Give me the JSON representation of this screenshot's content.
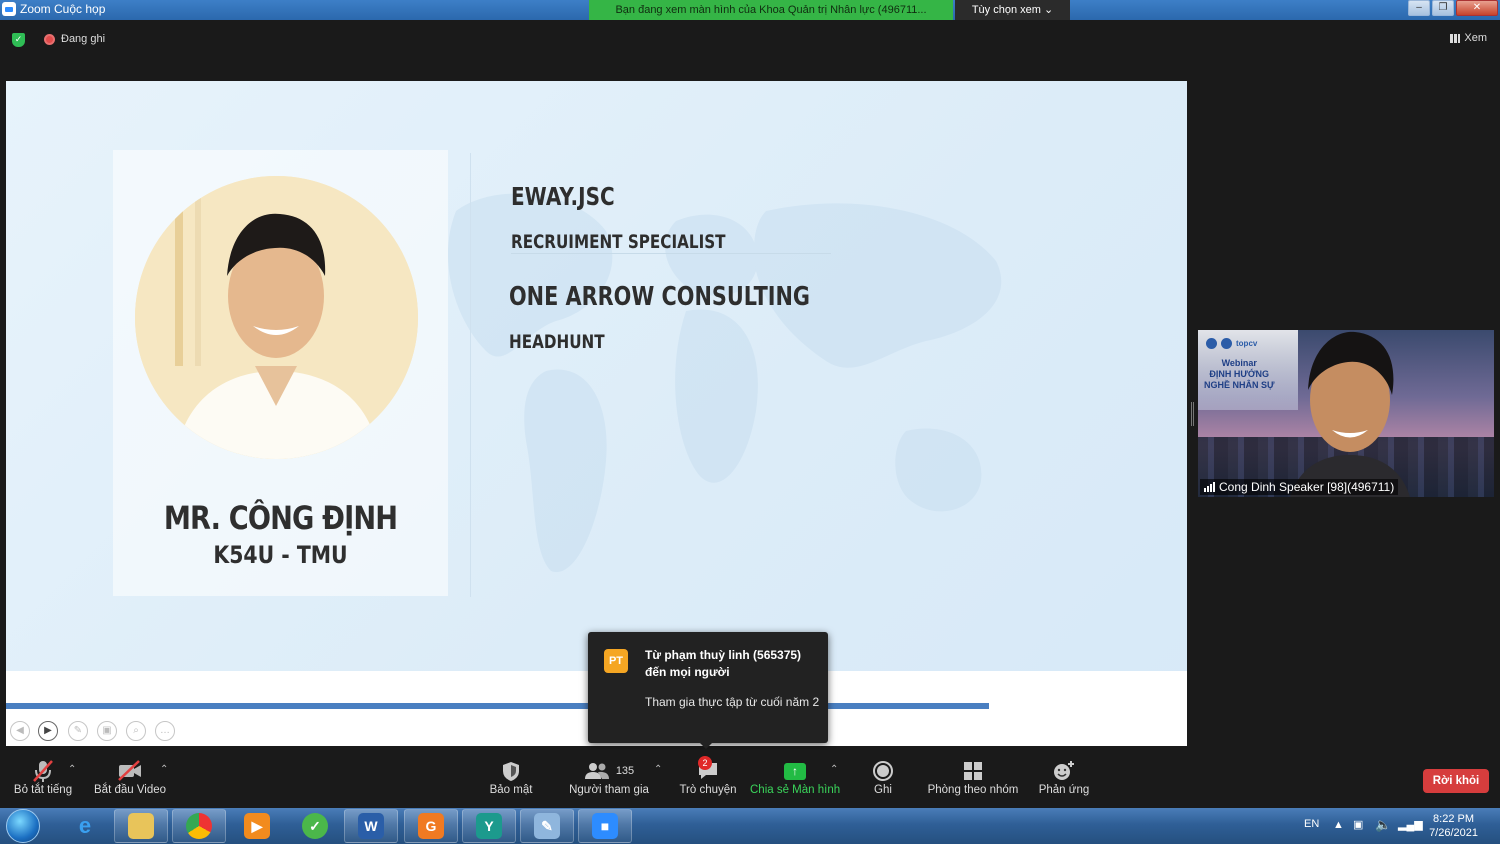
{
  "window": {
    "title": "Zoom Cuộc họp",
    "viewing_banner": "Bạn đang xem màn hình của Khoa Quản trị Nhân lực (496711...",
    "view_options": "Tùy chọn xem ⌄"
  },
  "meeting_header": {
    "recording_label": "Đang ghi",
    "view_label": "Xem"
  },
  "slide": {
    "name": "MR. CÔNG ĐỊNH",
    "class": "K54U - TMU",
    "company1": "EWAY.JSC",
    "role1": "RECRUIMENT SPECIALIST",
    "company2": "ONE ARROW CONSULTING",
    "role2": "HEADHUNT"
  },
  "video_tile": {
    "speaker_name": "Cong Dinh Speaker [98](496711)",
    "overlay_brand": "topcv",
    "overlay_lines": [
      "Webinar",
      "ĐỊNH HƯỚNG",
      "NGHỀ NHÂN SỰ"
    ]
  },
  "chat_toast": {
    "avatar_initials": "PT",
    "from": "Từ phạm thuỳ linh (565375) đến mọi người",
    "message": "Tham gia thực tập từ cuối năm 2"
  },
  "toolbar": {
    "mute_label": "Bỏ tắt tiếng",
    "video_label": "Bắt đầu Video",
    "security_label": "Bảo mật",
    "participants_label": "Người tham gia",
    "participants_count": "135",
    "chat_label": "Trò chuyện",
    "chat_badge": "2",
    "share_label": "Chia sẻ Màn hình",
    "record_label": "Ghi",
    "breakout_label": "Phòng theo nhóm",
    "reactions_label": "Phản ứng",
    "leave_label": "Rời khỏi"
  },
  "taskbar": {
    "language": "EN",
    "time": "8:22 PM",
    "date": "7/26/2021"
  },
  "colors": {
    "share_green": "#22bb44",
    "leave_red": "#d63d3d",
    "banner_green": "#35b546",
    "toast_avatar": "#f5a623"
  }
}
